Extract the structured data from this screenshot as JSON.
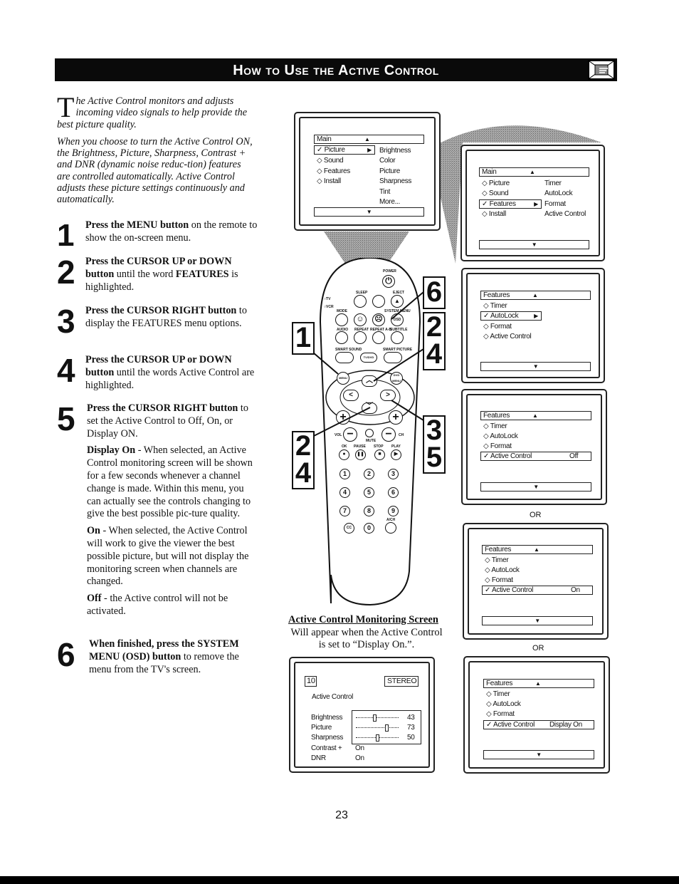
{
  "header": {
    "title": "How to Use the Active Control",
    "icon": "pointing-hand-icon"
  },
  "intro": {
    "dropcap": "T",
    "para1": "he Active Control monitors and adjusts incoming video signals to help provide the best picture quality.",
    "para2": "When you choose to turn the Active Control ON, the Brightness, Picture, Sharpness, Contrast + and DNR (dynamic noise reduc-tion) features are controlled automatically. Active Control adjusts these picture settings continuously and automatically."
  },
  "steps": [
    {
      "num": "1",
      "bold": "Press the MENU button",
      "text": " on the remote to show the on-screen menu."
    },
    {
      "num": "2",
      "bold": "Press the CURSOR UP or DOWN button",
      "text": " until the word ",
      "bold2": "FEATURES",
      "text2": " is highlighted."
    },
    {
      "num": "3",
      "bold": "Press the CURSOR RIGHT button",
      "text": " to display the FEATURES menu options."
    },
    {
      "num": "4",
      "bold": "Press the CURSOR UP or DOWN button",
      "text": " until the words Active Control are highlighted."
    },
    {
      "num": "5",
      "bold": "Press the CURSOR RIGHT button",
      "text": " to set the Active Control to Off, On, or Display ON.",
      "options": [
        {
          "bold": "Display On",
          "text": " - When selected, an Active Control monitoring screen will be shown for a few seconds whenever a channel change is made. Within this menu, you can actually see the controls changing to give the best possible pic-ture quality."
        },
        {
          "bold": "On",
          "text": " - When selected, the Active Control will work to give the viewer the best possible picture, but will not display the monitoring screen when channels are changed."
        },
        {
          "bold": "Off",
          "text": " - the Active control will not be activated."
        }
      ]
    },
    {
      "num": "6",
      "bold": "When finished, press the SYSTEM MENU (OSD) button",
      "text": " to remove the menu from the TV's screen."
    }
  ],
  "screen1": {
    "title": "Main",
    "up": "▲",
    "down": "▼",
    "left": [
      {
        "mark": "✓",
        "label": "Picture",
        "selected": true,
        "arrow": "▶"
      },
      {
        "mark": "◇",
        "label": "Sound"
      },
      {
        "mark": "◇",
        "label": "Features"
      },
      {
        "mark": "◇",
        "label": "Install"
      }
    ],
    "right": [
      "Brightness",
      "Color",
      "Picture",
      "Sharpness",
      "Tint",
      "More..."
    ]
  },
  "screen2": {
    "title": "Main",
    "up": "▲",
    "down": "▼",
    "left": [
      {
        "mark": "◇",
        "label": "Picture"
      },
      {
        "mark": "◇",
        "label": "Sound"
      },
      {
        "mark": "✓",
        "label": "Features",
        "selected": true,
        "arrow": "▶"
      },
      {
        "mark": "◇",
        "label": "Install"
      }
    ],
    "right": [
      "Timer",
      "AutoLock",
      "Format",
      "Active Control"
    ]
  },
  "screen3": {
    "title": "Features",
    "up": "▲",
    "down": "▼",
    "items": [
      {
        "mark": "◇",
        "label": "Timer"
      },
      {
        "mark": "✓",
        "label": "AutoLock",
        "selected": true,
        "arrow": "▶"
      },
      {
        "mark": "◇",
        "label": "Format"
      },
      {
        "mark": "◇",
        "label": "Active Control"
      }
    ]
  },
  "screen4": {
    "title": "Features",
    "up": "▲",
    "down": "▼",
    "items": [
      {
        "mark": "◇",
        "label": "Timer"
      },
      {
        "mark": "◇",
        "label": "AutoLock"
      },
      {
        "mark": "◇",
        "label": "Format"
      },
      {
        "mark": "✓",
        "label": "Active Control",
        "selected": true,
        "value": "Off"
      }
    ]
  },
  "or_label": "OR",
  "screen5": {
    "title": "Features",
    "up": "▲",
    "down": "▼",
    "items": [
      {
        "mark": "◇",
        "label": "Timer"
      },
      {
        "mark": "◇",
        "label": "AutoLock"
      },
      {
        "mark": "◇",
        "label": "Format"
      },
      {
        "mark": "✓",
        "label": "Active Control",
        "selected": true,
        "value": "On"
      }
    ]
  },
  "screen6": {
    "title": "Features",
    "up": "▲",
    "down": "▼",
    "items": [
      {
        "mark": "◇",
        "label": "Timer"
      },
      {
        "mark": "◇",
        "label": "AutoLock"
      },
      {
        "mark": "◇",
        "label": "Format"
      },
      {
        "mark": "✓",
        "label": "Active Control",
        "selected": true,
        "value": "Display On"
      }
    ]
  },
  "monitor": {
    "title": "Active Control Monitoring Screen",
    "desc": "Will appear when the Active Control is set to “Display On.”.",
    "channel": "10",
    "audio": "STEREO",
    "heading": "Active Control",
    "sliders": [
      {
        "label": "Brightness",
        "value": "43",
        "fraction": 0.43
      },
      {
        "label": "Picture",
        "value": "73",
        "fraction": 0.73
      },
      {
        "label": "Sharpness",
        "value": "50",
        "fraction": 0.5
      }
    ],
    "toggles": [
      {
        "label": "Contrast +",
        "value": "On"
      },
      {
        "label": "DNR",
        "value": "On"
      }
    ]
  },
  "remote": {
    "labels": {
      "power": "POWER",
      "sleep": "SLEEP",
      "eject": "EJECT",
      "tv": "TV",
      "vcr": "VCR",
      "mode": "MODE",
      "system_menu": "SYSTEM MENU",
      "osd": "OSD",
      "audio": "AUDIO",
      "repeat": "REPEAT",
      "repeat_ab": "REPEAT A-B",
      "subtitle": "SUBTITLE",
      "smart_sound": "SMART SOUND",
      "smart_picture": "SMART PICTURE",
      "tvdvd": "TV/DVD",
      "menu": "MENU",
      "dvd_menu": "DVD MENU",
      "vol": "VOL",
      "ch": "CH",
      "mute": "MUTE",
      "ok": "OK",
      "pause": "PAUSE",
      "stop": "STOP",
      "play": "PLAY",
      "cc": "CC",
      "ach": "A/CH"
    },
    "digits": [
      "1",
      "2",
      "3",
      "4",
      "5",
      "6",
      "7",
      "8",
      "9",
      "0"
    ],
    "callouts": {
      "c1": "1",
      "c6": "6",
      "c24a": "2",
      "c24b": "4",
      "c24c": "2",
      "c24d": "4",
      "c35a": "3",
      "c35b": "5"
    }
  },
  "page_number": "23"
}
